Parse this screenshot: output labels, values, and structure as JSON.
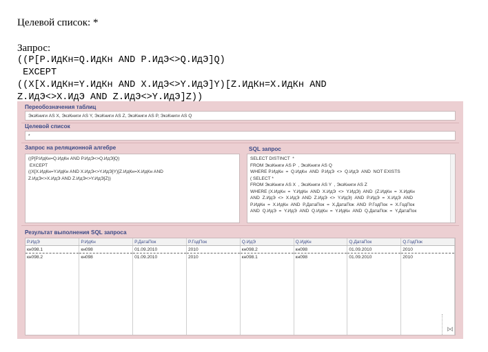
{
  "doc": {
    "target_line": "Целевой список: *",
    "query_label": "Запрос:",
    "query_lines": [
      "((P[P.ИдКн=Q.ИдКн AND P.ИдЭ<>Q.ИдЭ]Q)",
      " EXCEPT",
      "((X[X.ИдКн=Y.ИдКн AND X.ИдЭ<>Y.ИдЭ]Y)[Z.ИдКн=X.ИдКн AND",
      "Z.ИдЭ<>X.ИдЭ AND Z.ИдЭ<>Y.ИдЭ]Z))"
    ]
  },
  "app": {
    "renames": {
      "title": "Переобозначения таблиц",
      "value": "ЭкзКниги AS X, ЭкзКниги AS Y, ЭкзКниги AS Z, ЭкзКниги AS P, ЭкзКниги AS Q"
    },
    "target": {
      "title": "Целевой список",
      "value": "*"
    },
    "algebra": {
      "title": "Запрос на реляционной алгебре",
      "lines": [
        "((P[P.ИдКн=Q.ИдКн AND P.ИдЭ<>Q.ИдЭ]Q)",
        " EXCEPT",
        "((X[X.ИдКн=Y.ИдКн AND X.ИдЭ<>Y.ИдЭ]Y)[Z.ИдКн=X.ИдКн AND",
        "Z.ИдЭ<>X.ИдЭ AND Z.ИдЭ<>Y.ИдЭ]Z))"
      ]
    },
    "sql": {
      "title": "SQL запрос",
      "lines": [
        "SELECT DISTINCT  *",
        "FROM ЭкзКниги AS P  , ЭкзКниги AS Q",
        "WHERE P.ИдКн  =  Q.ИдКн  AND  P.ИдЭ  <>  Q.ИдЭ  AND  NOT EXISTS",
        "( SELECT *",
        "FROM ЭкзКниги AS X  , ЭкзКниги AS Y  , ЭкзКниги AS Z",
        "WHERE (X.ИдКн  =  Y.ИдКн  AND  X.ИдЭ  <>  Y.ИдЭ)  AND  (Z.ИдКн  =  X.ИдКн",
        "AND  Z.ИдЭ  <>  X.ИдЭ  AND  Z.ИдЭ  <>  Y.ИдЭ)  AND  P.ИдЭ  =  X.ИдЭ  AND",
        "P.ИдКн  =  X.ИдКн  AND  P.ДатаПок  =  X.ДатаПок  AND  P.ГодПок  =  X.ГодПок",
        "AND  Q.ИдЭ  =  Y.ИдЭ  AND  Q.ИдКн  =  Y.ИдКн  AND  Q.ДатаПок  =  Y.ДатаПок"
      ]
    },
    "result": {
      "title": "Результат выполнения SQL запроса",
      "columns": [
        "P.ИдЭ",
        "P.ИдКн",
        "P.ДатаПок",
        "P.ГодПок",
        "Q.ИдЭ",
        "Q.ИдКн",
        "Q.ДатаПок",
        "Q.ГодПок"
      ],
      "rows": [
        [
          "кн098.1",
          "кн098",
          "01.09.2010",
          "2010",
          "кн098.2",
          "кн098",
          "01.09.2010",
          "2010"
        ],
        [
          "кн098.2",
          "кн098",
          "01.09.2010",
          "2010",
          "кн098.1",
          "кн098",
          "01.09.2010",
          "2010"
        ]
      ]
    }
  }
}
